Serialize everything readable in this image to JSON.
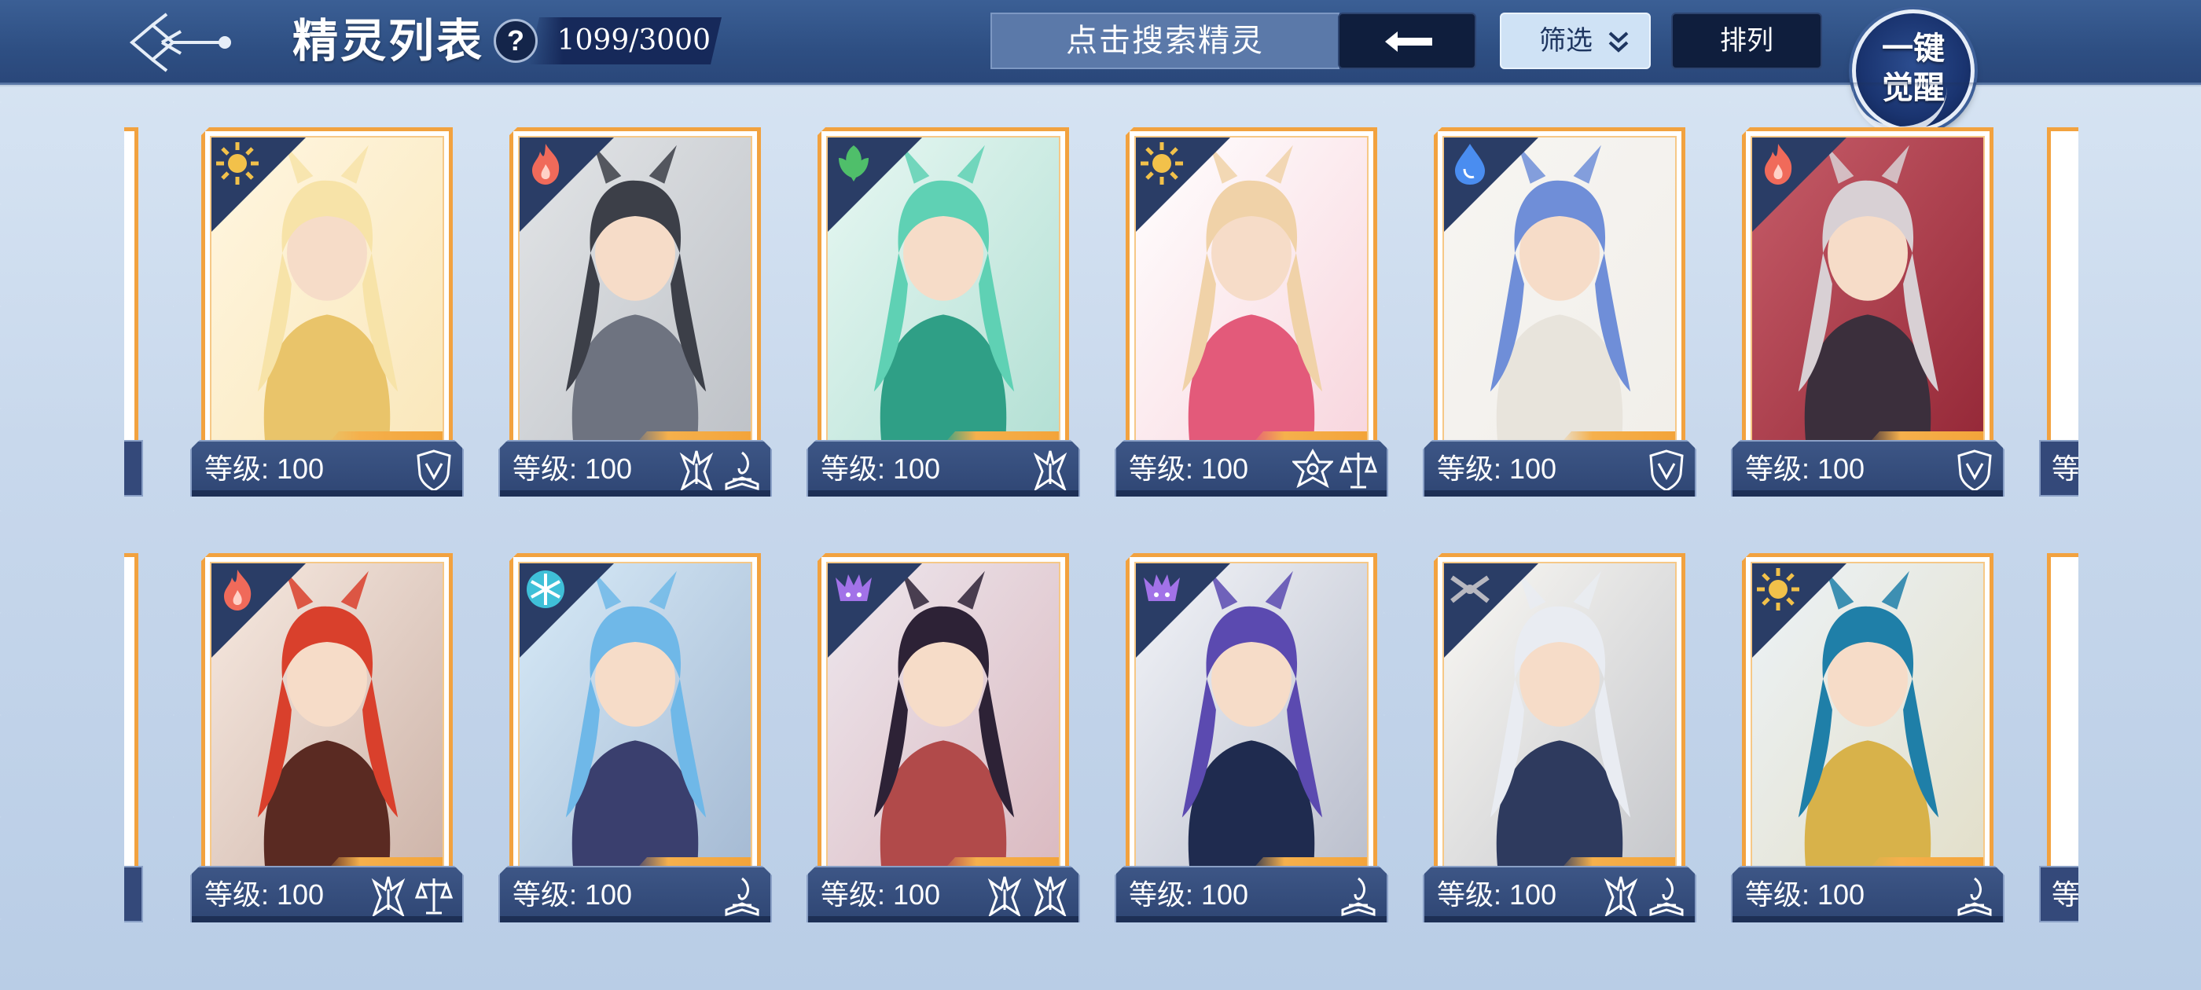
{
  "header": {
    "title": "精灵列表",
    "help_label": "?",
    "count": "1099/3000",
    "search_placeholder": "点击搜索精灵",
    "filter_label": "筛选",
    "sort_label": "排列",
    "awaken_line1": "一键",
    "awaken_line2": "觉醒"
  },
  "colors": {
    "header_bg": "#2e4f83",
    "card_border": "#f2a23f",
    "level_bar": "#34497a",
    "filter_bg": "#cfe2f5"
  },
  "level_label_prefix": "等级",
  "rows": [
    {
      "cards": [
        {
          "element": "light",
          "element_color": "#f2c14a",
          "art": [
            "#f7e3a8",
            "#e9c46a",
            "#fff3d6"
          ],
          "level": "等级: 100",
          "badges": [
            "shield-icon"
          ]
        },
        {
          "element": "fire",
          "element_color": "#f06a5a",
          "art": [
            "#3c3f48",
            "#6e7380",
            "#d9dcdf"
          ],
          "level": "等级: 100",
          "badges": [
            "mask-icon",
            "book-icon"
          ]
        },
        {
          "element": "grass",
          "element_color": "#4fbf6a",
          "art": [
            "#5fd1b4",
            "#2f9f86",
            "#dff5ee"
          ],
          "level": "等级: 100",
          "badges": [
            "mask-icon"
          ]
        },
        {
          "element": "light",
          "element_color": "#f2c14a",
          "art": [
            "#f0d2a8",
            "#e35a7a",
            "#ffffff"
          ],
          "level": "等级: 100",
          "badges": [
            "star-emblem-icon",
            "scale-icon"
          ]
        },
        {
          "element": "water",
          "element_color": "#4a8df0",
          "art": [
            "#6f8ed8",
            "#e8e4dc",
            "#f4f2ee"
          ],
          "level": "等级: 100",
          "badges": [
            "shield-icon"
          ]
        },
        {
          "element": "fire",
          "element_color": "#f06a5a",
          "art": [
            "#d8d0d4",
            "#3b2f3c",
            "#b32636"
          ],
          "level": "等级: 100",
          "badges": [
            "shield-icon"
          ]
        }
      ]
    },
    {
      "cards": [
        {
          "element": "fire",
          "element_color": "#f06a5a",
          "art": [
            "#d9402c",
            "#5a2a22",
            "#f4e2d6"
          ],
          "level": "等级: 100",
          "badges": [
            "mask-icon",
            "scale-icon"
          ]
        },
        {
          "element": "ice",
          "element_color": "#3fc0d8",
          "art": [
            "#6fb8e8",
            "#3a3f6e",
            "#c9e3f5"
          ],
          "level": "等级: 100",
          "badges": [
            "book-icon"
          ]
        },
        {
          "element": "dark",
          "element_color": "#a272e8",
          "art": [
            "#2d2236",
            "#b14a4a",
            "#e8dfe8"
          ],
          "level": "等级: 100",
          "badges": [
            "mask-icon",
            "mask-icon"
          ]
        },
        {
          "element": "dark",
          "element_color": "#a272e8",
          "art": [
            "#5b4ab0",
            "#1f2b4f",
            "#eef0f6"
          ],
          "level": "等级: 100",
          "badges": [
            "book-icon"
          ]
        },
        {
          "element": "dual",
          "element_color": "#b8b8c0",
          "art": [
            "#e9ecf2",
            "#2e3a5e",
            "#f8f6f0"
          ],
          "level": "等级: 100",
          "badges": [
            "mask-icon",
            "book-icon"
          ]
        },
        {
          "element": "light",
          "element_color": "#f2c14a",
          "art": [
            "#1f7fa8",
            "#d8b24a",
            "#e6eef4"
          ],
          "level": "等级: 100",
          "badges": [
            "book-icon"
          ]
        }
      ]
    }
  ],
  "edge_right_label": "等"
}
